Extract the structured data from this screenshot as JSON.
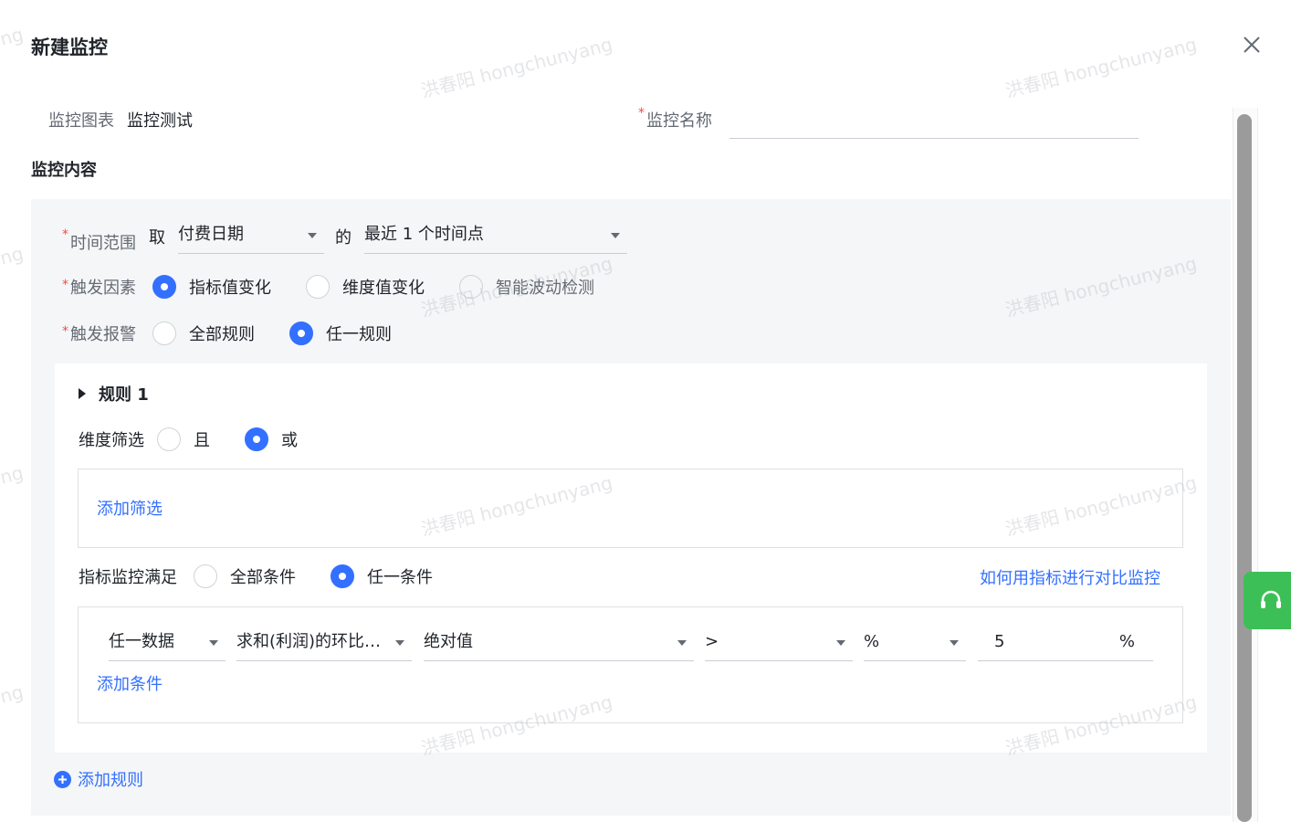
{
  "dialog": {
    "title": "新建监控"
  },
  "chart_field": {
    "label": "监控图表",
    "value": "监控测试"
  },
  "name_field": {
    "label": "监控名称",
    "value": ""
  },
  "section": {
    "title": "监控内容"
  },
  "time_range": {
    "label": "时间范围",
    "take": "取",
    "date_select": "付费日期",
    "of": "的",
    "period_select": "最近 1 个时间点"
  },
  "trigger_factor": {
    "label": "触发因素",
    "options": [
      "指标值变化",
      "维度值变化",
      "智能波动检测"
    ],
    "selected": "指标值变化"
  },
  "trigger_alarm": {
    "label": "触发报警",
    "options": [
      "全部规则",
      "任一规则"
    ],
    "selected": "任一规则"
  },
  "rule": {
    "title": "规则 1",
    "dimension_filter": {
      "label": "维度筛选",
      "options": [
        "且",
        "或"
      ],
      "selected": "或"
    },
    "add_filter": "添加筛选",
    "metric_satisfy": {
      "label": "指标监控满足",
      "options": [
        "全部条件",
        "任一条件"
      ],
      "selected": "任一条件"
    },
    "help_link": "如何用指标进行对比监控",
    "condition": {
      "data_select": "任一数据",
      "metric_select": "求和(利润)的环比…",
      "mode_select": "绝对值",
      "operator_select": ">",
      "unit_select": "%",
      "value": "5",
      "value_unit": "%"
    },
    "add_condition": "添加条件"
  },
  "add_rule": "添加规则",
  "watermark": "洪春阳 hongchunyang",
  "watermark_fragment": "ng",
  "colors": {
    "primary": "#3370ff",
    "required": "#f54a45",
    "support": "#3dbf58"
  }
}
